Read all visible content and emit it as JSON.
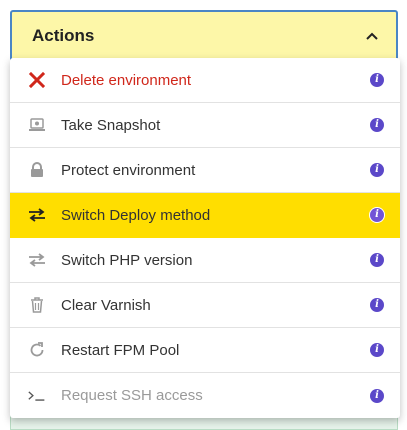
{
  "actions_button": {
    "label": "Actions",
    "expanded": true
  },
  "menu": {
    "items": [
      {
        "label": "Delete environment",
        "icon": "close-icon",
        "variant": "danger"
      },
      {
        "label": "Take Snapshot",
        "icon": "camera-icon",
        "variant": "normal"
      },
      {
        "label": "Protect environment",
        "icon": "lock-icon",
        "variant": "normal"
      },
      {
        "label": "Switch Deploy method",
        "icon": "swap-arrows-icon",
        "variant": "highlighted"
      },
      {
        "label": "Switch PHP version",
        "icon": "swap-arrows-icon",
        "variant": "normal"
      },
      {
        "label": "Clear Varnish",
        "icon": "trash-icon",
        "variant": "normal"
      },
      {
        "label": "Restart FPM Pool",
        "icon": "refresh-icon",
        "variant": "normal"
      },
      {
        "label": "Request SSH access",
        "icon": "terminal-icon",
        "variant": "disabled"
      }
    ],
    "info_glyph": "i"
  },
  "colors": {
    "button_bg": "#fdf7a8",
    "button_border": "#4a86c5",
    "highlight": "#ffde00",
    "danger": "#d0271b",
    "info": "#5b48c9"
  }
}
